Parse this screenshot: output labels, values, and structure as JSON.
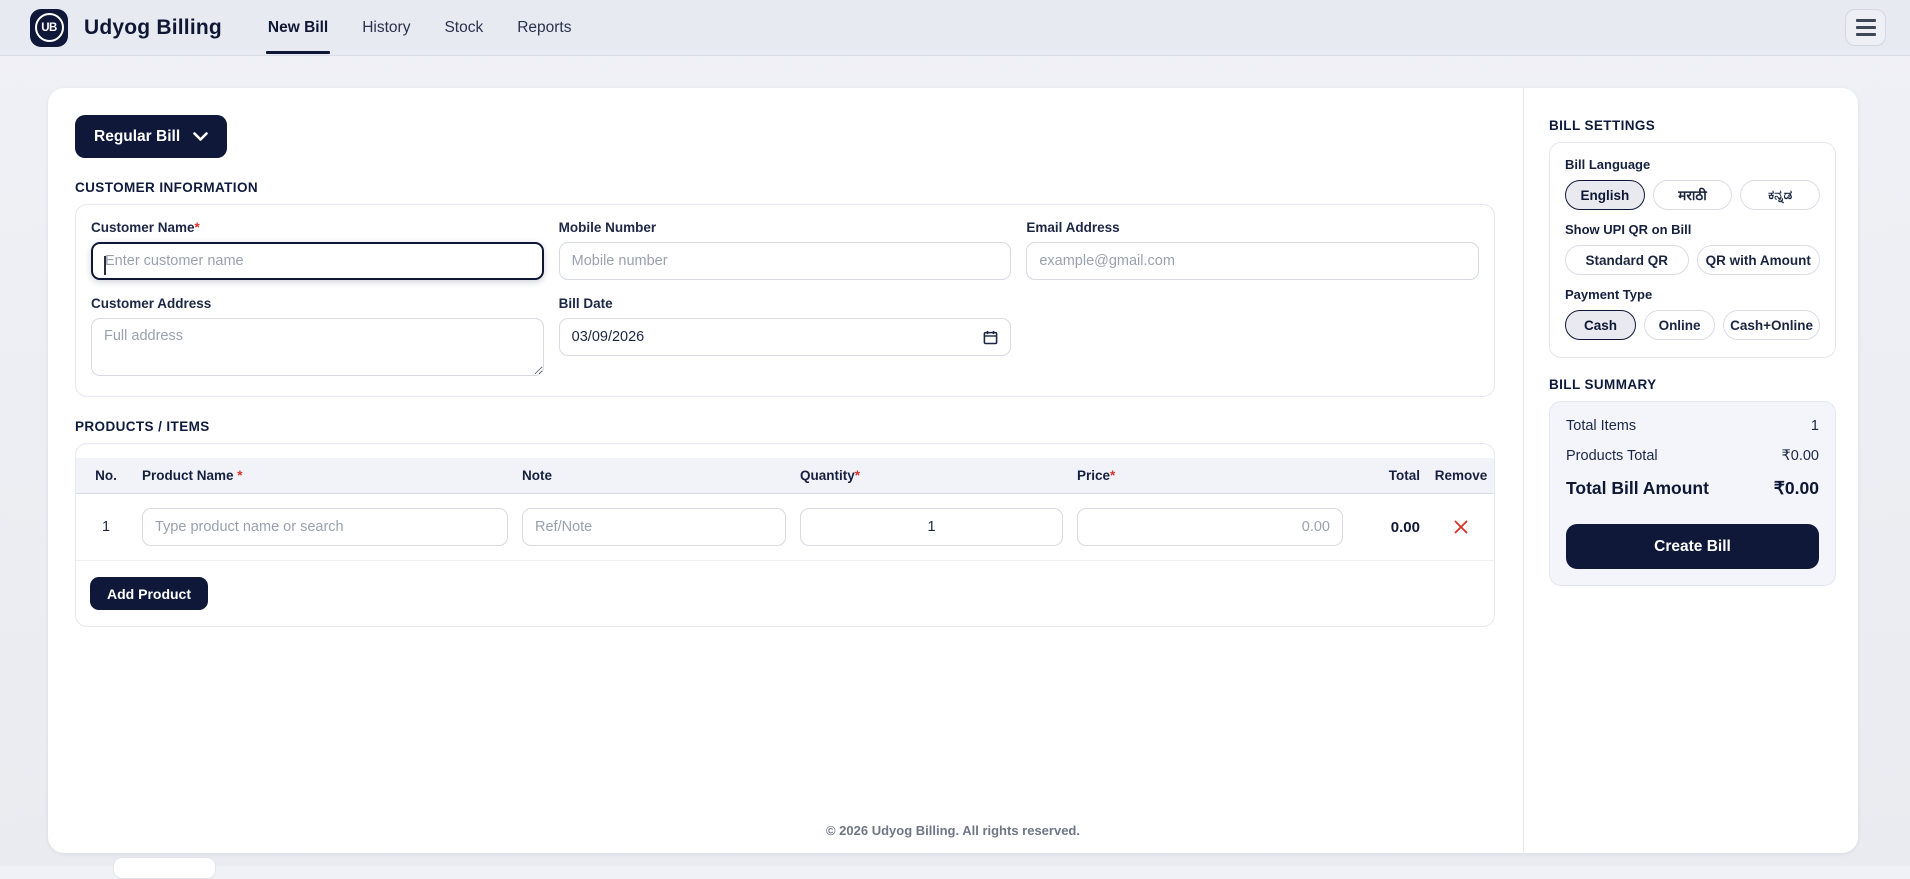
{
  "navbar": {
    "logo_text": "UB",
    "brand": "Udyog Billing",
    "items": [
      {
        "label": "New Bill",
        "active": true
      },
      {
        "label": "History",
        "active": false
      },
      {
        "label": "Stock",
        "active": false
      },
      {
        "label": "Reports",
        "active": false
      }
    ]
  },
  "bill_type": {
    "selected": "Regular Bill"
  },
  "customer_info": {
    "title": "CUSTOMER INFORMATION",
    "fields": {
      "name": {
        "label": "Customer Name",
        "req": "*",
        "placeholder": "Enter customer name",
        "value": ""
      },
      "mobile": {
        "label": "Mobile Number",
        "req": "",
        "placeholder": "Mobile number",
        "value": ""
      },
      "email": {
        "label": "Email Address",
        "req": "",
        "placeholder": "example@gmail.com",
        "value": ""
      },
      "address": {
        "label": "Customer Address",
        "req": "",
        "placeholder": "Full address",
        "value": ""
      },
      "bill_date": {
        "label": "Bill Date",
        "value": "03/09/2026"
      }
    }
  },
  "products": {
    "title": "PRODUCTS / ITEMS",
    "columns": [
      {
        "label": "No.",
        "req": ""
      },
      {
        "label": "Product Name",
        "req": " *"
      },
      {
        "label": "Note",
        "req": ""
      },
      {
        "label": "Quantity",
        "req": "*"
      },
      {
        "label": "Price",
        "req": "*"
      },
      {
        "label": "Total",
        "req": ""
      },
      {
        "label": "Remove",
        "req": ""
      }
    ],
    "rows": [
      {
        "no": "1",
        "product_placeholder": "Type product name or search",
        "product_value": "",
        "note_placeholder": "Ref/Note",
        "note_value": "",
        "quantity": "1",
        "price_placeholder": "0.00",
        "price_value": "",
        "total": "0.00"
      }
    ],
    "add_button": "Add Product"
  },
  "bill_settings": {
    "title": "BILL SETTINGS",
    "language": {
      "label": "Bill Language",
      "options": [
        "English",
        "मराठी",
        "ಕನ್ನಡ"
      ],
      "selected": "English"
    },
    "upi_qr": {
      "label": "Show UPI QR on Bill",
      "options": [
        "Standard QR",
        "QR with Amount"
      ],
      "selected": ""
    },
    "payment_type": {
      "label": "Payment Type",
      "options": [
        "Cash",
        "Online",
        "Cash+Online"
      ],
      "selected": "Cash"
    }
  },
  "bill_summary": {
    "title": "BILL SUMMARY",
    "rows": [
      {
        "label": "Total Items",
        "value": "1"
      },
      {
        "label": "Products Total",
        "value": "₹0.00"
      }
    ],
    "total_label": "Total Bill Amount",
    "total_value": "₹0.00",
    "create_button": "Create Bill"
  },
  "footer": {
    "copyright": "© 2026 Udyog Billing. All rights reserved."
  },
  "colors": {
    "navy": "#10183a",
    "accent_red": "#d9342b"
  }
}
